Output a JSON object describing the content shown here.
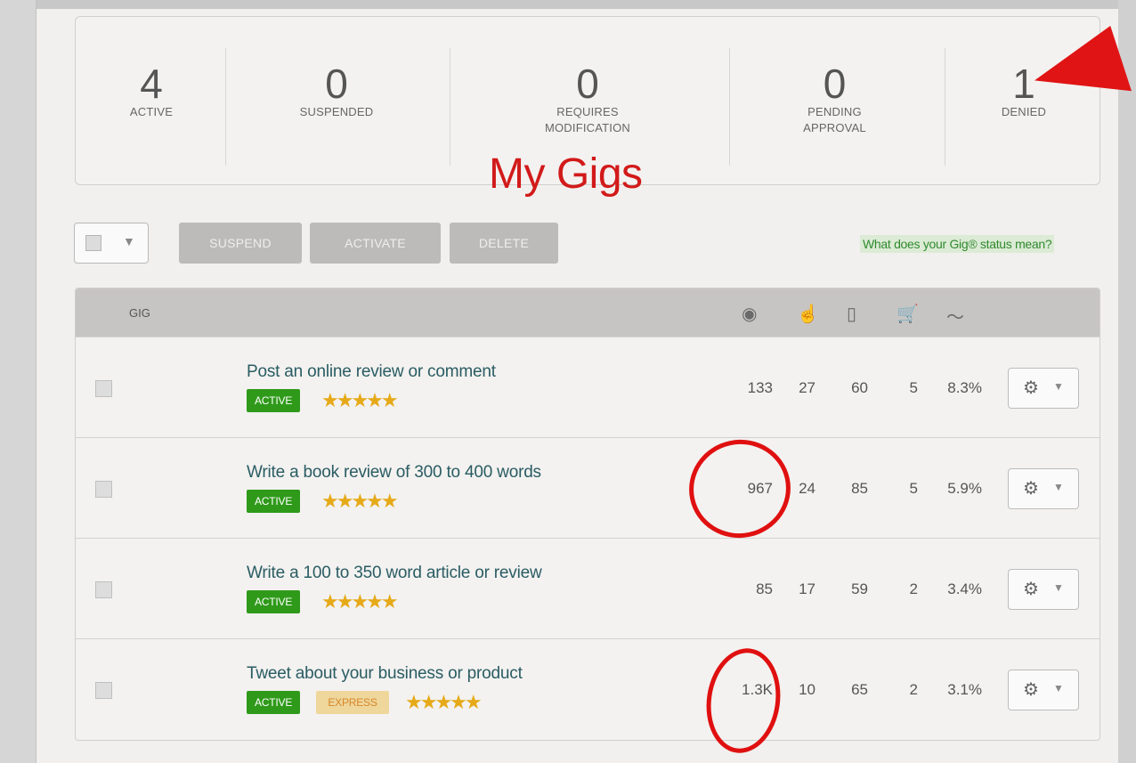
{
  "stats": [
    {
      "value": "4",
      "label": "ACTIVE"
    },
    {
      "value": "0",
      "label": "SUSPENDED"
    },
    {
      "value": "0",
      "label": "REQUIRES MODIFICATION"
    },
    {
      "value": "0",
      "label": "PENDING APPROVAL"
    },
    {
      "value": "1",
      "label": "DENIED"
    }
  ],
  "annotation_title": "My Gigs",
  "toolbar": {
    "suspend": "SUSPEND",
    "activate": "ACTIVATE",
    "delete": "DELETE",
    "status_link": "What does your Gig® status mean?"
  },
  "table": {
    "gig_header": "GIG",
    "header_icons": [
      "views-icon",
      "clicks-icon",
      "impressions-icon",
      "orders-icon",
      "conversion-icon"
    ],
    "rows": [
      {
        "title": "Post an online review or comment",
        "status": "ACTIVE",
        "express": "",
        "views": "133",
        "clicks": "27",
        "impressions": "60",
        "orders": "5",
        "conversion": "8.3%"
      },
      {
        "title": "Write a book review of 300 to 400 words",
        "status": "ACTIVE",
        "express": "",
        "views": "967",
        "clicks": "24",
        "impressions": "85",
        "orders": "5",
        "conversion": "5.9%"
      },
      {
        "title": "Write a 100 to 350 word article or review",
        "status": "ACTIVE",
        "express": "",
        "views": "85",
        "clicks": "17",
        "impressions": "59",
        "orders": "2",
        "conversion": "3.4%"
      },
      {
        "title": "Tweet about your business or product",
        "status": "ACTIVE",
        "express": "EXPRESS",
        "views": "1.3K",
        "clicks": "10",
        "impressions": "65",
        "orders": "2",
        "conversion": "3.1%"
      }
    ]
  },
  "rating_stars": "★★★★★",
  "colors": {
    "annotation_red": "#e01010",
    "active_green": "#2f9a1a",
    "title_teal": "#2a5c63",
    "star_gold": "#e6a918"
  }
}
